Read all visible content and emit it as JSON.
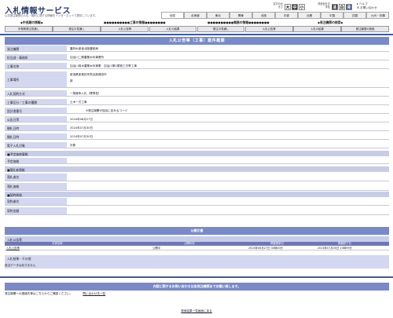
{
  "header": {
    "logo": "入札情報サービス",
    "tagline": "公共発注機関の入札・契約に関する情報をインターネットで提供しています。",
    "font_size": {
      "label": "文字の大きさ",
      "small": "大",
      "medium": "中",
      "large": "小"
    },
    "bg_color": {
      "label": "背景色を文字色",
      "black": "黒",
      "white": "白",
      "blue": "青"
    },
    "help": "ヘルプ",
    "contact": "お問い合わせ"
  },
  "regions": [
    "全国",
    "北海道",
    "東北",
    "関東",
    "北陸",
    "中部",
    "近畿",
    "中国",
    "四国",
    "九州・沖縄"
  ],
  "categories": [
    {
      "title": "◆中長期の情報◆",
      "buttons": [
        "中長期発注見通し"
      ]
    },
    {
      "title": "●●●●●●●●●●工事の情報●●●●●●●●",
      "buttons": [
        "発注の見通し",
        "入札公告等",
        "入札の結果"
      ]
    },
    {
      "title": "●●●●●●●●●●業務の情報●●●●●●●●",
      "buttons": [
        "発注の見通し",
        "入札公告等",
        "入札の結果"
      ]
    },
    {
      "title": "◆発注機関の検索◆",
      "buttons": [
        "発注機関の検索"
      ]
    }
  ],
  "page_title": "入札公告等（工事）案件概要",
  "details": [
    {
      "label": "発注機関",
      "value": "農林水産省北陸農政局"
    },
    {
      "label": "担当部・事務所",
      "value": "加治川二期農業水利事業所"
    },
    {
      "label": "工事名称",
      "value": "加治川用水農業水利事業　加治川第2頭首工付帯工事"
    },
    {
      "label": "工事場所",
      "value": "新潟県新発田市荒谷新発田市",
      "value2": "新"
    },
    {
      "label": "入札契約方式",
      "value": "一般競争入札（標準型）"
    },
    {
      "label": "工事区分／工事の種類",
      "value": "土木一式工事"
    },
    {
      "label": "設計書番号",
      "value": "※発注機関が独自に定めるコード"
    },
    {
      "label": "公告日等",
      "value": "2024年06月27日"
    },
    {
      "label": "開札日時",
      "value": "2024年07月30日"
    },
    {
      "label": "開札日時",
      "value": "2024年07月30日"
    },
    {
      "label": "電子入札対象",
      "value": "対象"
    }
  ],
  "sections": {
    "estimate": {
      "title": "■予定価格情報",
      "fields": [
        {
          "label": "予定価格",
          "value": ""
        }
      ]
    },
    "winner": {
      "title": "■落札者情報",
      "fields": [
        {
          "label": "落札者名",
          "value": ""
        },
        {
          "label": "落札価格",
          "value": ""
        }
      ]
    },
    "contract": {
      "title": "■契約情報",
      "fields": [
        {
          "label": "契約者名",
          "value": ""
        },
        {
          "label": "契約金額",
          "value": ""
        }
      ]
    }
  },
  "related": {
    "title": "公開文書",
    "subtitle": "入札公告等",
    "columns": [
      "文書名称",
      "公開状況",
      "掲載更新日",
      "掲載終了日"
    ],
    "rows": [
      {
        "name": "入札公告等",
        "status": "公開中",
        "updated": "2024年06月27日 04時00分",
        "end": "2024年07月30日 23時59分"
      }
    ],
    "other_title": "入札結果・その他",
    "other_none": "該当データはありません"
  },
  "inquiry": {
    "title": "内容に関するお問い合わせは各発注機関までお願い致します。",
    "text": "発注機関への連絡先等はこちらからご確認ください。",
    "link": "問い合わせ先一覧"
  },
  "back_link": "検索結果一覧画面に戻る",
  "colors": {
    "accent": "#7a89c9",
    "label_bg": "#d3d7ef",
    "band": "#3b5ba0"
  }
}
